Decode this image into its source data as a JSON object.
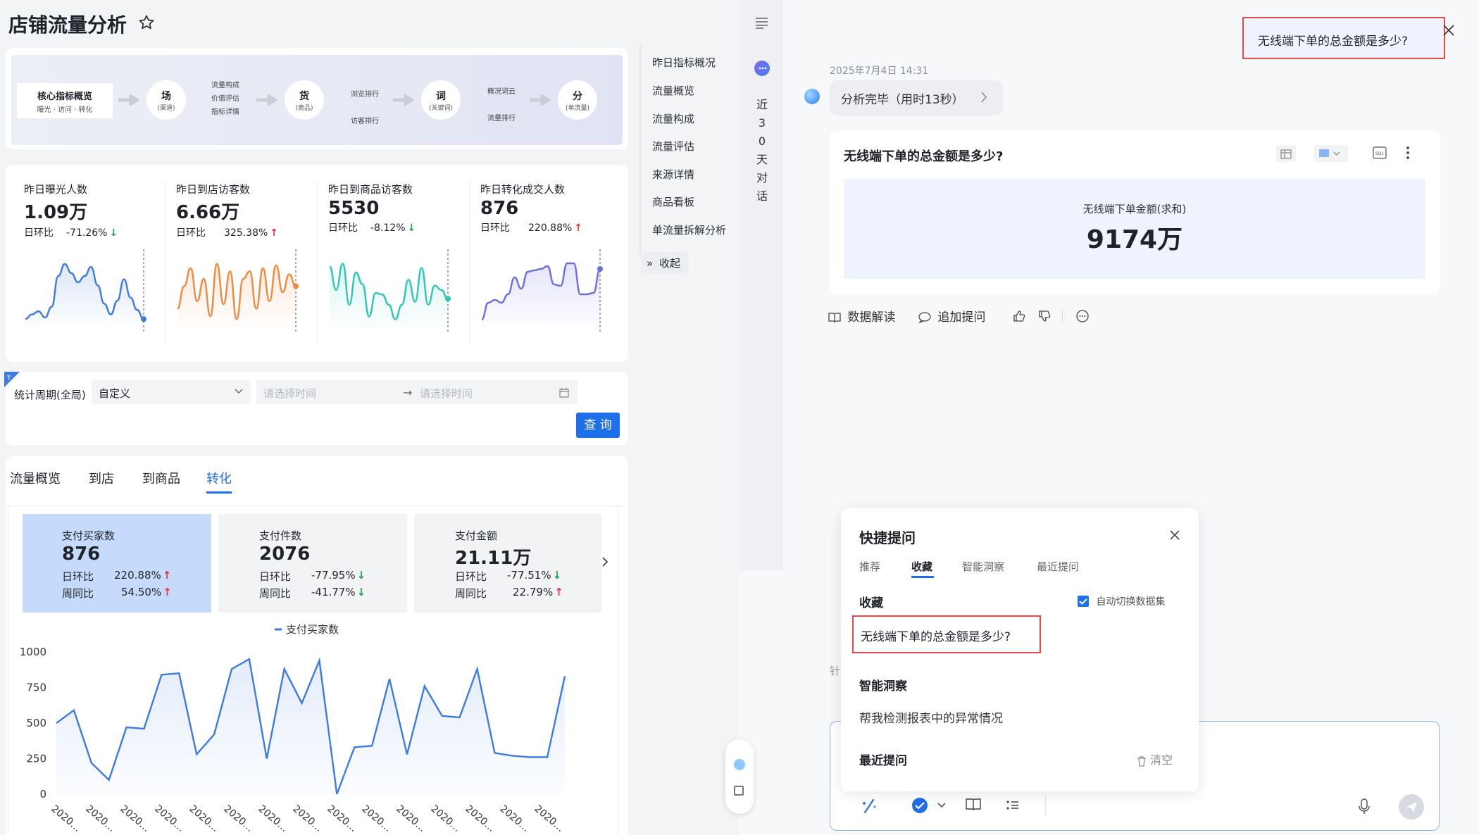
{
  "page": {
    "title": "店铺流量分析"
  },
  "flow": {
    "steps": [
      {
        "title": "核心指标概览",
        "sub": "曝光 · 访问 · 转化"
      },
      {
        "title": "场",
        "sub": "(渠道)"
      },
      {
        "title": "货",
        "sub": "(商品)"
      },
      {
        "title": "词",
        "sub": "(关键词)"
      },
      {
        "title": "分",
        "sub": "(单流量)"
      }
    ],
    "branches": {
      "chang": [
        "流量构成",
        "价值评估",
        "指标详情"
      ],
      "huo": [
        "浏览排行",
        "访客排行"
      ],
      "ci": [
        "概况词云",
        "流量排行"
      ]
    }
  },
  "kpis": [
    {
      "label": "昨日曝光人数",
      "value": "1.09万",
      "cmp": "日环比",
      "change": "-71.26%",
      "dir": "down",
      "color": "#3d7be0",
      "series": [
        52,
        55,
        57,
        53,
        60,
        80,
        88,
        82,
        76,
        80,
        86,
        74,
        62,
        55,
        64,
        78,
        66,
        58,
        52
      ]
    },
    {
      "label": "昨日到店访客数",
      "value": "6.66万",
      "cmp": "日环比",
      "change": "325.38%",
      "dir": "up",
      "color": "#f2883d",
      "series": [
        55,
        70,
        82,
        60,
        75,
        50,
        85,
        58,
        80,
        48,
        75,
        80,
        55,
        82,
        60,
        84,
        66,
        78,
        70
      ]
    },
    {
      "label": "昨日到商品访客数",
      "value": "5530",
      "cmp": "日环比",
      "change": "-8.12%",
      "dir": "down",
      "color": "#2cc8b4",
      "series": [
        86,
        70,
        88,
        60,
        82,
        74,
        52,
        68,
        67,
        60,
        50,
        60,
        77,
        62,
        85,
        60,
        73,
        70,
        64
      ]
    },
    {
      "label": "昨日转化成交人数",
      "value": "876",
      "cmp": "日环比",
      "change": "220.88%",
      "dir": "up",
      "color": "#6b6ee0",
      "series": [
        50,
        62,
        64,
        62,
        68,
        80,
        72,
        84,
        85,
        86,
        88,
        75,
        74,
        90,
        90,
        68,
        68,
        69,
        86
      ]
    }
  ],
  "filter": {
    "label": "统计周期(全局)",
    "select_value": "自定义",
    "start_placeholder": "请选择时间",
    "end_placeholder": "请选择时间",
    "query_label": "查 询"
  },
  "sideNav": {
    "items": [
      "昨日指标概况",
      "流量概览",
      "流量构成",
      "流量评估",
      "来源详情",
      "商品看板",
      "单流量拆解分析"
    ],
    "collapse_label": "收起"
  },
  "tabs": [
    "流量概览",
    "到店",
    "到商品",
    "转化"
  ],
  "metricCards": [
    {
      "title": "支付买家数",
      "value": "876",
      "d_label": "日环比",
      "d_val": "220.88%",
      "d_dir": "up",
      "w_label": "周同比",
      "w_val": "54.50%",
      "w_dir": "up"
    },
    {
      "title": "支付件数",
      "value": "2076",
      "d_label": "日环比",
      "d_val": "-77.95%",
      "d_dir": "down",
      "w_label": "周同比",
      "w_val": "-41.77%",
      "w_dir": "down"
    },
    {
      "title": "支付金额",
      "value": "21.11万",
      "d_label": "日环比",
      "d_val": "-77.51%",
      "d_dir": "down",
      "w_label": "周同比",
      "w_val": "22.79%",
      "w_dir": "up"
    }
  ],
  "chart_data": {
    "type": "area",
    "legend": "支付买家数",
    "yticks": [
      "1000",
      "750",
      "500",
      "250",
      "0"
    ],
    "ylim": [
      0,
      1000
    ],
    "x": [
      "2020…",
      "2020…",
      "2020…",
      "2020…",
      "2020…",
      "2020…",
      "2020…",
      "2020…",
      "2020…",
      "2020…",
      "2020…",
      "2020…",
      "2020…",
      "2020…",
      "2020…"
    ],
    "series": [
      {
        "name": "支付买家数",
        "values": [
          500,
          590,
          220,
          100,
          470,
          460,
          840,
          850,
          280,
          420,
          880,
          950,
          250,
          880,
          640,
          940,
          0,
          330,
          340,
          810,
          280,
          760,
          550,
          540,
          880,
          290,
          270,
          260,
          260,
          830
        ]
      }
    ],
    "color": "#3d7be0"
  },
  "chat": {
    "date": "2025年7月4日 14:31",
    "status": "分析完毕（用时13秒）",
    "question_bubble": "无线端下单的总金额是多少?",
    "card_title": "无线端下单的总金额是多少?",
    "metric_label": "无线端下单金额(求和)",
    "metric_value": "9174万",
    "actions": [
      "数据解读",
      "追加提问"
    ],
    "rail_label": "近30天对话",
    "rail_chars": [
      "近",
      "3",
      "0",
      "天",
      "对",
      "话"
    ],
    "input_prefix": "针"
  },
  "quick": {
    "title": "快捷提问",
    "tabs": [
      "推荐",
      "收藏",
      "智能洞察",
      "最近提问"
    ],
    "section_fav": "收藏",
    "auto_switch": "自动切换数据集",
    "fav_item": "无线端下单的总金额是多少?",
    "section_insight": "智能洞察",
    "insight_item": "帮我检测报表中的异常情况",
    "section_recent": "最近提问",
    "clear_label": "清空"
  }
}
